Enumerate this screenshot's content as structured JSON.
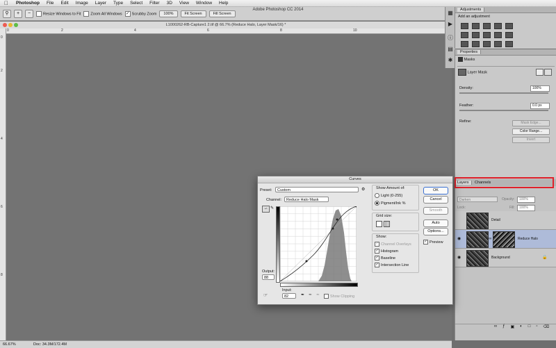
{
  "menubar": {
    "app": "Photoshop",
    "items": [
      "File",
      "Edit",
      "Image",
      "Layer",
      "Type",
      "Select",
      "Filter",
      "3D",
      "View",
      "Window",
      "Help"
    ]
  },
  "app_title": "Adobe Photoshop CC 2014",
  "options": {
    "resize_windows": "Resize Windows to Fit",
    "zoom_all": "Zoom All Windows",
    "scrubby_zoom": "Scrubby Zoom",
    "pct_btn": "100%",
    "fit_btn": "Fit Screen",
    "fill_btn": "Fill Screen"
  },
  "document": {
    "title": "L1000262-RB-Capture1 2.tif @ 66.7% (Reduce Halo, Layer Mask/16) *"
  },
  "rulers": {
    "h": [
      "0",
      "2",
      "4",
      "6",
      "8",
      "10"
    ],
    "v": [
      "0",
      "2",
      "4",
      "6",
      "8"
    ]
  },
  "status": {
    "zoom": "66.67%",
    "doc": "Doc: 34.3M/172.4M"
  },
  "adjustments": {
    "tab": "Adjustments",
    "heading": "Add an adjustment"
  },
  "properties": {
    "tab": "Properties",
    "masks_label": "Masks",
    "layer_mask": "Layer Mask",
    "density_label": "Density:",
    "density_value": "100%",
    "feather_label": "Feather:",
    "feather_value": "0.0 px",
    "refine_label": "Refine:",
    "mask_edge": "Mask Edge...",
    "color_range": "Color Range...",
    "invert": "Invert"
  },
  "layers_panel": {
    "tabs": [
      "Layers",
      "Channels"
    ],
    "blend_mode": "Darken",
    "opacity_label": "Opacity:",
    "opacity_value": "100%",
    "fill_label": "Fill:",
    "fill_value": "100%",
    "lock_label": "Lock:",
    "layers": [
      {
        "name": "Detail",
        "visible": false,
        "selected": false
      },
      {
        "name": "Reduce Halo",
        "visible": true,
        "selected": true
      },
      {
        "name": "Background",
        "visible": true,
        "selected": false
      }
    ]
  },
  "curves": {
    "title": "Curves",
    "preset_label": "Preset:",
    "preset_value": "Custom",
    "channel_label": "Channel:",
    "channel_value": "Reduce Halo Mask",
    "output_label": "Output:",
    "output_value": "88",
    "input_label": "Input:",
    "input_value": "82",
    "show_clipping": "Show Clipping",
    "show_amount_label": "Show Amount of:",
    "light_option": "Light  (0-255)",
    "pigment_option": "Pigment/Ink %",
    "grid_size_label": "Grid size:",
    "show_label": "Show:",
    "show_options": [
      "Channel Overlays",
      "Histogram",
      "Baseline",
      "Intersection Line"
    ],
    "ok": "OK",
    "cancel": "Cancel",
    "smooth": "Smooth",
    "auto": "Auto",
    "options": "Options...",
    "preview": "Preview"
  }
}
